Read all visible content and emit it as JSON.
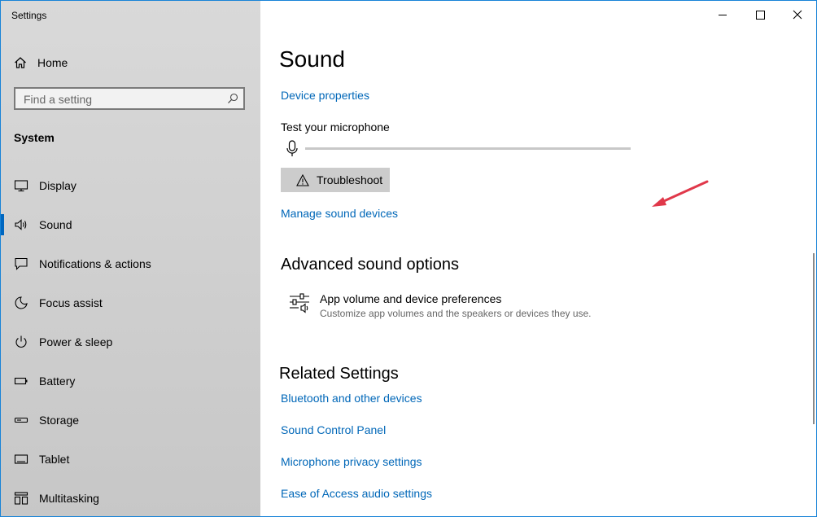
{
  "window": {
    "title": "Settings"
  },
  "sidebar": {
    "home_label": "Home",
    "search_placeholder": "Find a setting",
    "section_title": "System",
    "items": [
      {
        "label": "Display",
        "icon": "display-icon"
      },
      {
        "label": "Sound",
        "icon": "speaker-icon",
        "active": true
      },
      {
        "label": "Notifications & actions",
        "icon": "notification-icon"
      },
      {
        "label": "Focus assist",
        "icon": "moon-icon"
      },
      {
        "label": "Power & sleep",
        "icon": "power-icon"
      },
      {
        "label": "Battery",
        "icon": "battery-icon"
      },
      {
        "label": "Storage",
        "icon": "storage-icon"
      },
      {
        "label": "Tablet",
        "icon": "tablet-icon"
      },
      {
        "label": "Multitasking",
        "icon": "multitasking-icon"
      }
    ]
  },
  "main": {
    "title": "Sound",
    "device_properties": "Device properties",
    "test_mic_label": "Test your microphone",
    "troubleshoot_label": "Troubleshoot",
    "manage_devices": "Manage sound devices",
    "advanced_heading": "Advanced sound options",
    "app_volume_title": "App volume and device preferences",
    "app_volume_desc": "Customize app volumes and the speakers or devices they use.",
    "related_heading": "Related Settings",
    "related_links": [
      "Bluetooth and other devices",
      "Sound Control Panel",
      "Microphone privacy settings",
      "Ease of Access audio settings"
    ]
  },
  "colors": {
    "accent": "#0067b8",
    "sidebar_bg": "#d3d3d3",
    "annotation_arrow": "#e0384a"
  }
}
